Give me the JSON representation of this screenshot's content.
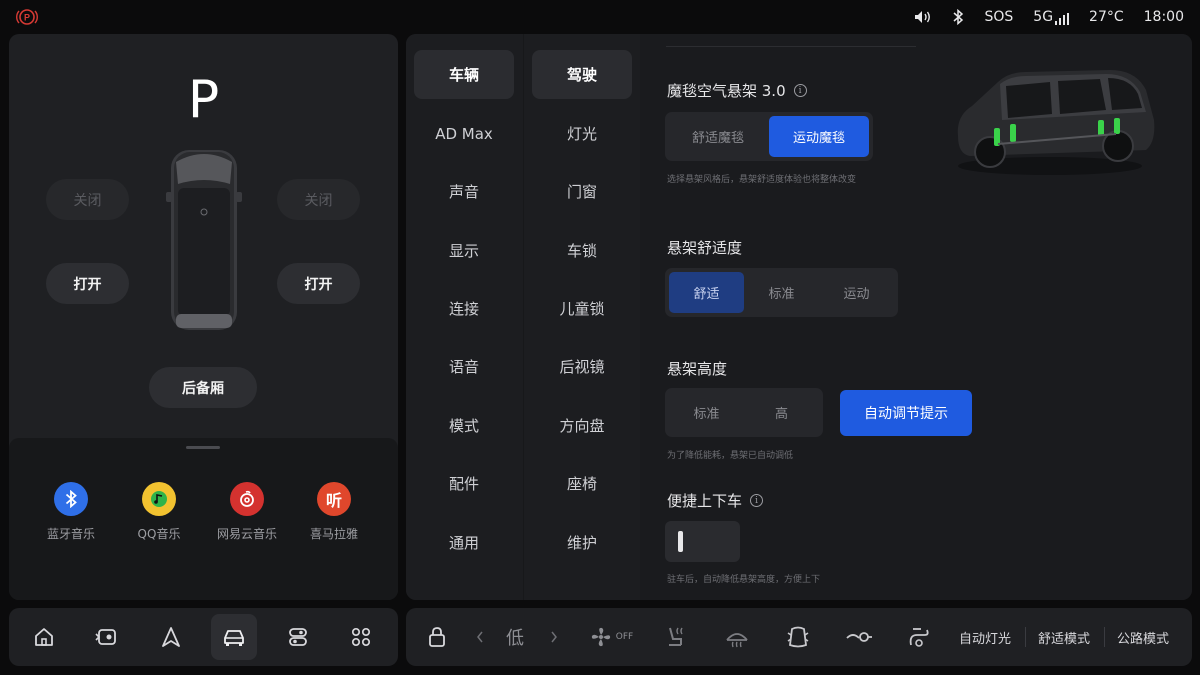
{
  "status": {
    "sos": "SOS",
    "network": "5G",
    "temperature": "27°C",
    "time": "18:00"
  },
  "vehicle": {
    "gear": "P",
    "front_left_door": "关闭",
    "front_right_door": "关闭",
    "rear_left_door": "打开",
    "rear_right_door": "打开",
    "trunk": "后备厢"
  },
  "media_apps": [
    {
      "label": "蓝牙音乐",
      "icon": "bluetooth-icon",
      "color": "#2f6fe8"
    },
    {
      "label": "QQ音乐",
      "icon": "qq-music-icon",
      "color": "#f2c230"
    },
    {
      "label": "网易云音乐",
      "icon": "netease-music-icon",
      "color": "#d4322f"
    },
    {
      "label": "喜马拉雅",
      "icon": "ximalaya-icon",
      "color": "#e0472c"
    }
  ],
  "nav_primary": [
    "车辆",
    "AD Max",
    "声音",
    "显示",
    "连接",
    "语音",
    "模式",
    "配件",
    "通用"
  ],
  "nav_secondary": [
    "驾驶",
    "灯光",
    "门窗",
    "车锁",
    "儿童锁",
    "后视镜",
    "方向盘",
    "座椅",
    "维护"
  ],
  "settings": {
    "air_suspension": {
      "title": "魔毯空气悬架 3.0",
      "options": [
        "舒适魔毯",
        "运动魔毯"
      ],
      "selected": "运动魔毯",
      "hint": "选择悬架风格后，悬架舒适度体验也将整体改变"
    },
    "comfort": {
      "title": "悬架舒适度",
      "options": [
        "舒适",
        "标准",
        "运动"
      ],
      "selected": "舒适"
    },
    "height": {
      "title": "悬架高度",
      "options": [
        "标准",
        "高"
      ],
      "button": "自动调节提示",
      "hint": "为了降低能耗，悬架已自动调低"
    },
    "easy_entry": {
      "title": "便捷上下车",
      "enabled": false,
      "hint": "驻车后，自动降低悬架高度，方便上下"
    }
  },
  "dock": {
    "fan_level": "低",
    "fan_status": "OFF",
    "auto_light": "自动灯光",
    "comfort_mode": "舒适模式",
    "road_mode": "公路模式"
  },
  "colors": {
    "accent": "#1f5be0",
    "accent_dim": "#1f3d82",
    "parking_red": "#d63a34",
    "suspension_green": "#3ad24a"
  }
}
